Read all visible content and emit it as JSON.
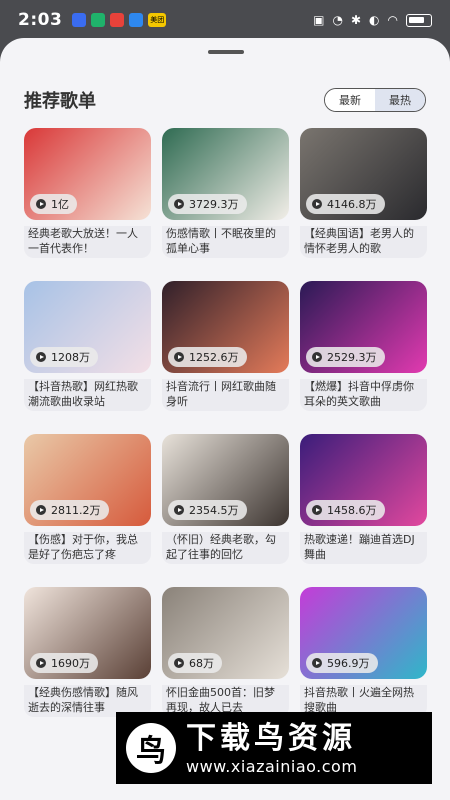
{
  "status_bar": {
    "time": "2:03",
    "apps": [
      {
        "icon": "music-app-icon",
        "color": "#3a6cf0"
      },
      {
        "icon": "download-app-icon",
        "color": "#1fb36b"
      },
      {
        "icon": "shop-app-icon",
        "color": "#e8423a"
      },
      {
        "icon": "cloud-app-icon",
        "color": "#2e88ef"
      },
      {
        "icon": "meituan-app-icon",
        "color": "#f5c800",
        "label": "美团"
      }
    ],
    "right_icons": [
      "nfc-icon",
      "alarm-icon",
      "bluetooth-icon",
      "silent-icon",
      "wifi-icon",
      "battery-icon"
    ]
  },
  "header": {
    "title": "推荐歌单",
    "tabs": [
      {
        "label": "最新",
        "active": false
      },
      {
        "label": "最热",
        "active": true
      }
    ]
  },
  "playlists": [
    {
      "plays": "1亿",
      "title": "经典老歌大放送！一人一首代表作！",
      "colors": [
        "#d93838",
        "#f5e2d6"
      ]
    },
    {
      "plays": "3729.3万",
      "title": "伤感情歌丨不眠夜里的孤单心事",
      "colors": [
        "#2f6b52",
        "#f2eee8"
      ]
    },
    {
      "plays": "4146.8万",
      "title": "【经典国语】老男人的情怀老男人的歌",
      "colors": [
        "#7a756f",
        "#2a2a2e"
      ]
    },
    {
      "plays": "1208万",
      "title": "【抖音热歌】网红热歌潮流歌曲收录站",
      "colors": [
        "#a7c2e6",
        "#f3dfe6"
      ]
    },
    {
      "plays": "1252.6万",
      "title": "抖音流行丨网红歌曲随身听",
      "colors": [
        "#30202a",
        "#e47b5a"
      ]
    },
    {
      "plays": "2529.3万",
      "title": "【燃爆】抖音中俘虏你耳朵的英文歌曲",
      "colors": [
        "#2a1a55",
        "#e23ab0"
      ]
    },
    {
      "plays": "2811.2万",
      "title": "【伤感】对于你，我总是好了伤疤忘了疼",
      "colors": [
        "#e9c9a8",
        "#d65a3c"
      ]
    },
    {
      "plays": "2354.5万",
      "title": "（怀旧）经典老歌，勾起了往事的回忆",
      "colors": [
        "#e8e2da",
        "#3c3430"
      ]
    },
    {
      "plays": "1458.6万",
      "title": "热歌速递！蹦迪首选DJ舞曲",
      "colors": [
        "#3a1d7a",
        "#e2489e"
      ]
    },
    {
      "plays": "1690万",
      "title": "【经典伤感情歌】随风逝去的深情往事",
      "colors": [
        "#f0e4dc",
        "#5a4036"
      ]
    },
    {
      "plays": "68万",
      "title": "怀旧金曲500首：旧梦再现，故人已去",
      "colors": [
        "#8a8279",
        "#e6e0d8"
      ]
    },
    {
      "plays": "596.9万",
      "title": "抖音热歌丨火遍全网热搜歌曲",
      "colors": [
        "#c43cd8",
        "#2fb7c9"
      ]
    }
  ],
  "watermark": {
    "logo_char": "鸟",
    "text": "下载鸟资源",
    "url": "www.xiazainiao.com"
  }
}
